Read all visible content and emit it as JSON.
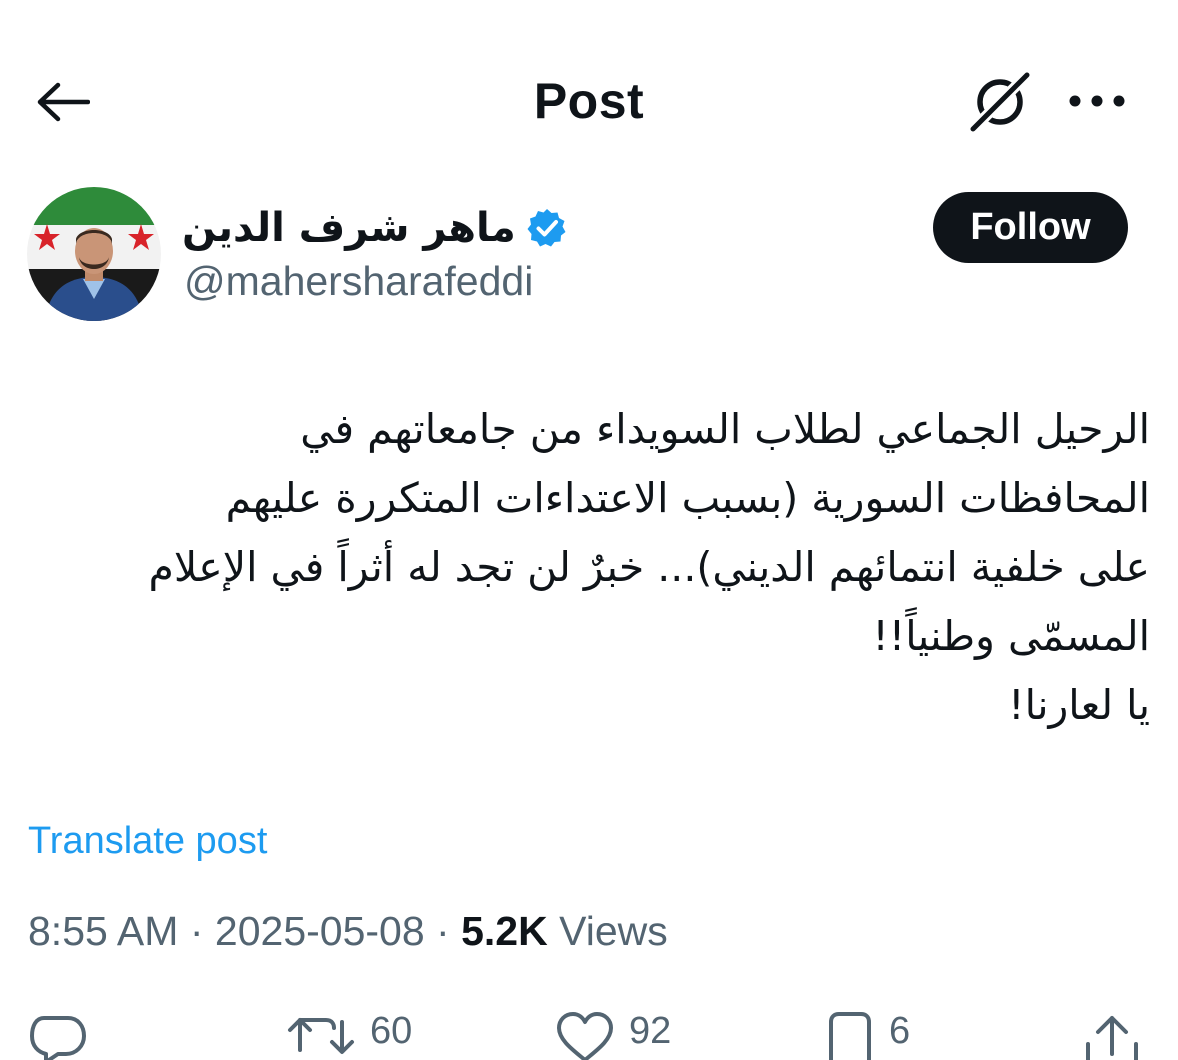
{
  "header": {
    "title": "Post"
  },
  "author": {
    "name": "ماهر شرف الدين",
    "handle": "@mahersharafeddi",
    "follow_label": "Follow"
  },
  "post": {
    "lines": [
      "الرحيل الجماعي لطلاب السويداء من جامعاتهم في",
      "المحافظات السورية (بسبب الاعتداءات المتكررة عليهم",
      "على خلفية انتمائهم الديني)... خبرٌ لن تجد له أثراً في الإعلام",
      "المسمّى وطنياً!!",
      "يا لعارنا!"
    ],
    "translate_label": "Translate post",
    "time": "8:55 AM",
    "separator": "·",
    "date": "2025-05-08",
    "views_count": "5.2K",
    "views_label": "Views"
  },
  "actions": {
    "retweets": "60",
    "likes": "92",
    "bookmarks": "6"
  },
  "colors": {
    "text": "#0f1419",
    "secondary": "#536471",
    "link": "#1d9bf0",
    "verified": "#1d9bf0",
    "follow_bg": "#0f1419"
  }
}
